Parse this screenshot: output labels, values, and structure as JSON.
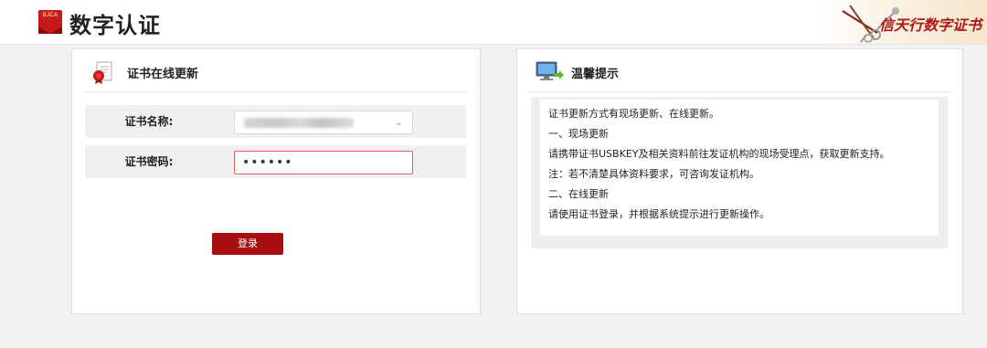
{
  "header": {
    "logo_text": "BJCA",
    "brand": "数字认证",
    "slogan": "信天行数字证书"
  },
  "update_panel": {
    "title": "证书在线更新",
    "cert_name_label": "证书名称:",
    "cert_password_label": "证书密码:",
    "cert_password_value": "••••••",
    "login_button": "登录"
  },
  "tips_panel": {
    "title": "温馨提示",
    "lines": [
      "证书更新方式有现场更新、在线更新。",
      "一、现场更新",
      "请携带证书USBKEY及相关资料前往发证机构的现场受理点，获取更新支持。",
      "注：若不清楚具体资料要求，可咨询发证机构。",
      "二、在线更新",
      "请使用证书登录，并根据系统提示进行更新操作。"
    ]
  },
  "colors": {
    "brand_red": "#c41a1a",
    "button_red": "#a80e0e",
    "page_bg": "#f1f1f3"
  }
}
